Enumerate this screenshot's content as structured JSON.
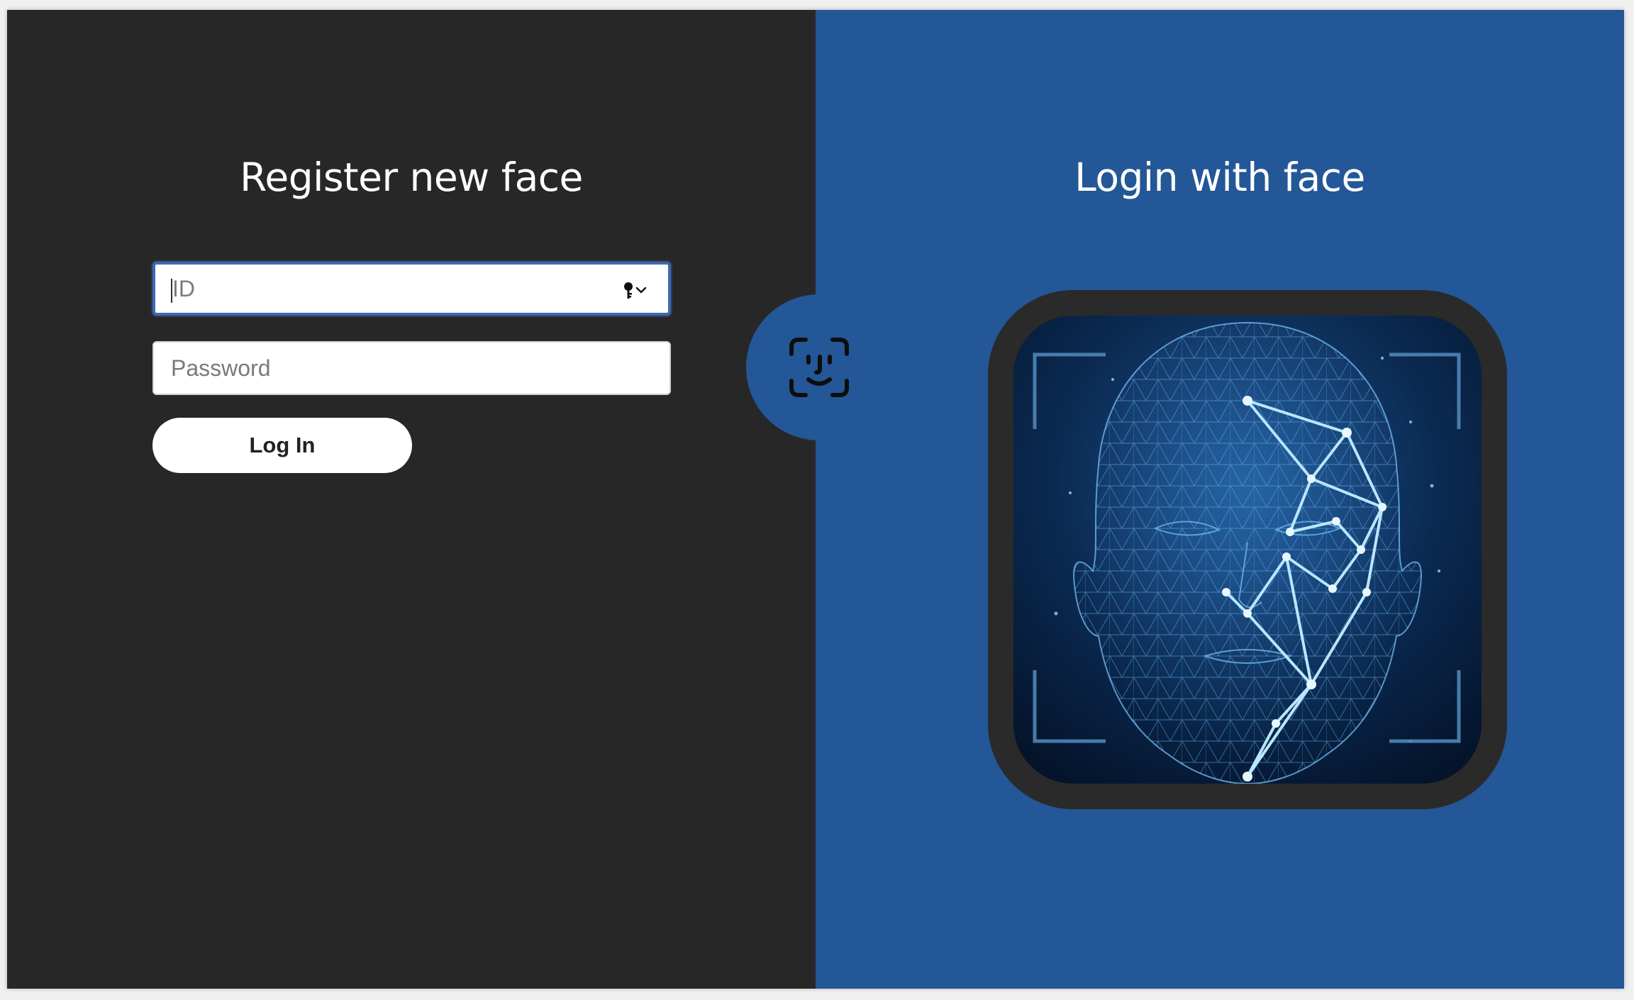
{
  "register": {
    "title": "Register new face",
    "id_placeholder": "ID",
    "password_placeholder": "Password",
    "login_label": "Log In",
    "key_icon": "key-icon"
  },
  "login": {
    "title": "Login with face",
    "face_id_icon": "face-id-icon",
    "illustration": "face-scan-illustration"
  },
  "colors": {
    "left_bg": "#282727",
    "right_bg": "#235797",
    "focus_border": "#3f68b0",
    "scan_frame": "#2a2a2a"
  }
}
